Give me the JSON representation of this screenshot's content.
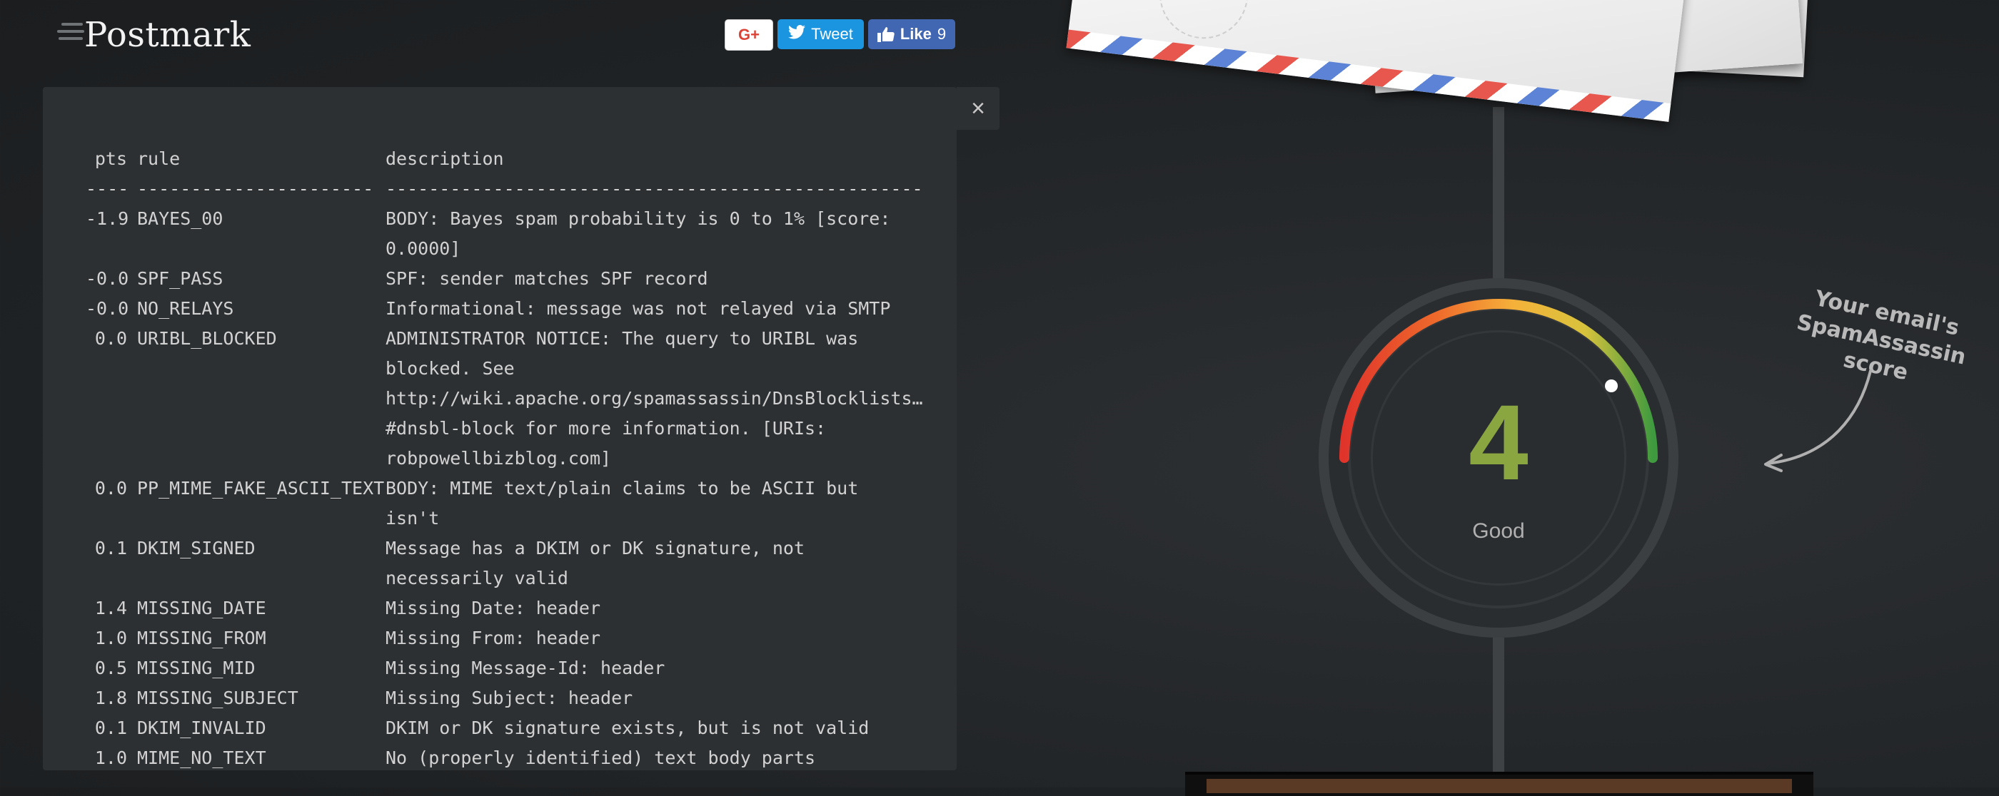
{
  "header": {
    "logo_text": "Postmark",
    "share": {
      "gplus_label": "G+",
      "tweet_label": "Tweet",
      "like_label": "Like",
      "like_count": "9"
    }
  },
  "report": {
    "close_label": "×",
    "columns": {
      "pts": "pts",
      "rule": "rule",
      "description": "description"
    },
    "separator": {
      "pts": "----",
      "rule": "----------------------",
      "description": "--------------------------------------------------"
    },
    "rows": [
      {
        "pts": "-1.9",
        "rule": "BAYES_00",
        "description": "BODY: Bayes spam probability is 0 to 1% [score:\n0.0000]"
      },
      {
        "pts": "-0.0",
        "rule": "SPF_PASS",
        "description": "SPF: sender matches SPF record"
      },
      {
        "pts": "-0.0",
        "rule": "NO_RELAYS",
        "description": "Informational: message was not relayed via SMTP"
      },
      {
        "pts": "0.0",
        "rule": "URIBL_BLOCKED",
        "description": "ADMINISTRATOR NOTICE: The query to URIBL was\nblocked. See\nhttp://wiki.apache.org/spamassassin/DnsBlocklists…\n#dnsbl-block for more information. [URIs:\nrobpowellbizblog.com]"
      },
      {
        "pts": "0.0",
        "rule": "PP_MIME_FAKE_ASCII_TEXT",
        "description": "BODY: MIME text/plain claims to be ASCII but isn't"
      },
      {
        "pts": "0.1",
        "rule": "DKIM_SIGNED",
        "description": "Message has a DKIM or DK signature, not\nnecessarily valid"
      },
      {
        "pts": "1.4",
        "rule": "MISSING_DATE",
        "description": "Missing Date: header"
      },
      {
        "pts": "1.0",
        "rule": "MISSING_FROM",
        "description": "Missing From: header"
      },
      {
        "pts": "0.5",
        "rule": "MISSING_MID",
        "description": "Missing Message-Id: header"
      },
      {
        "pts": "1.8",
        "rule": "MISSING_SUBJECT",
        "description": "Missing Subject: header"
      },
      {
        "pts": "0.1",
        "rule": "DKIM_INVALID",
        "description": "DKIM or DK signature exists, but is not valid"
      },
      {
        "pts": "1.0",
        "rule": "MIME_NO_TEXT",
        "description": "No (properly identified) text body parts"
      }
    ]
  },
  "gauge": {
    "score": "4",
    "verdict": "Good",
    "colors": {
      "score": "#8aa641",
      "arc_start": "#e0342b",
      "arc_mid": "#f5b13a",
      "arc_end": "#3f9a3f"
    }
  },
  "annotation": {
    "line1": "Your email's",
    "line2": "SpamAssassin score"
  }
}
